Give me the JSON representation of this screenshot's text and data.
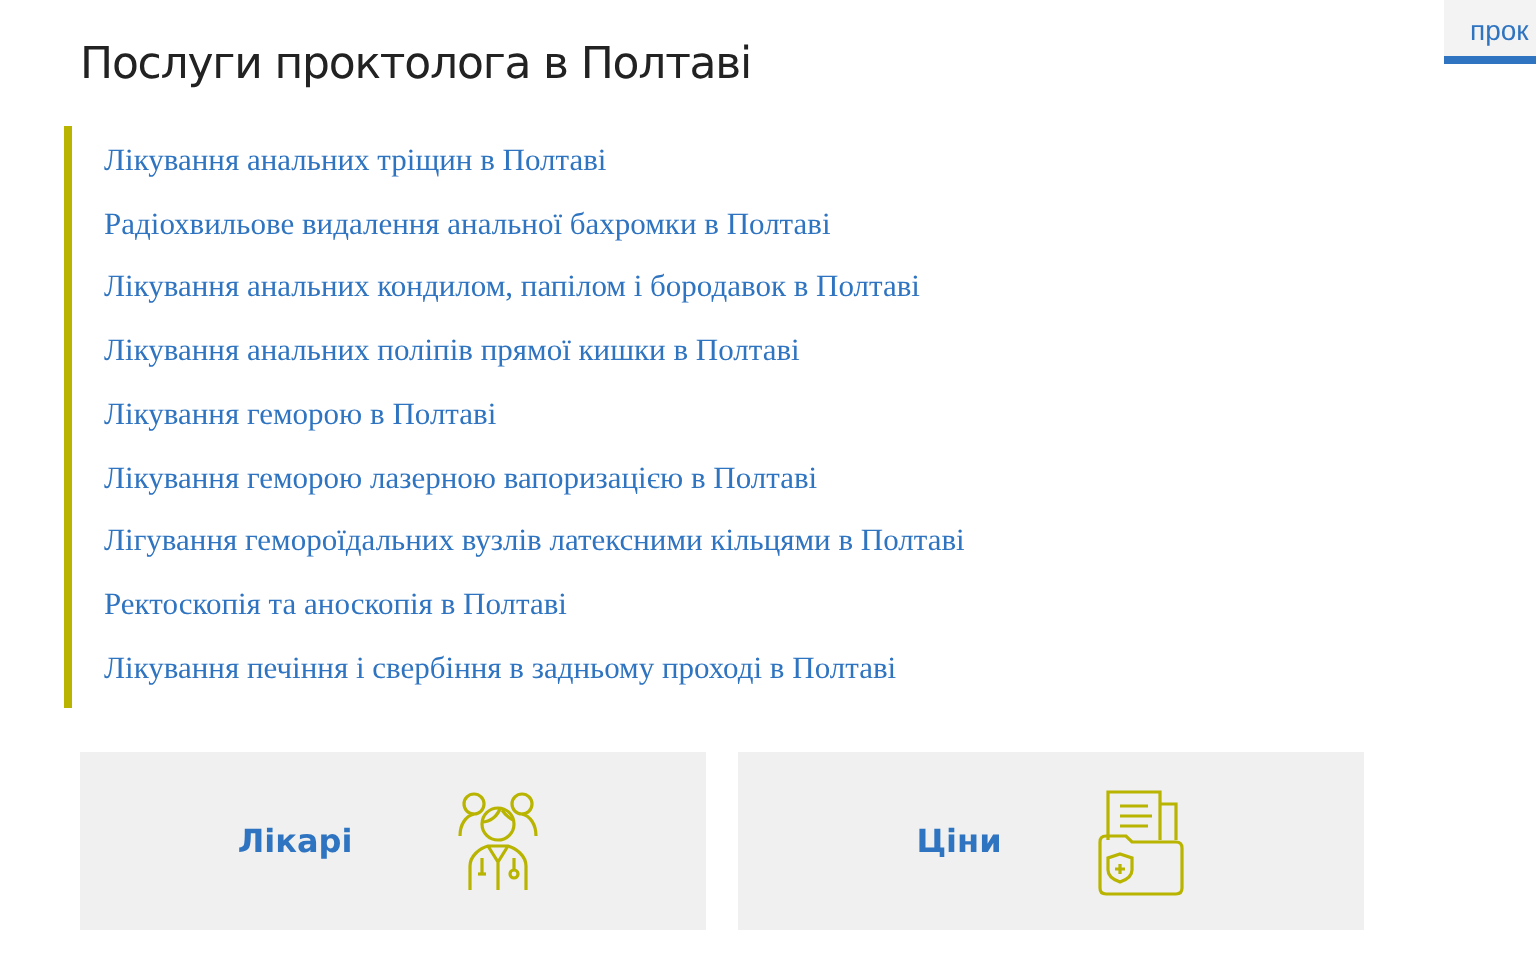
{
  "heading": "Послуги проктолога в Полтаві",
  "side_tab": {
    "label": "прок",
    "selected": true
  },
  "services": [
    "Лікування анальних тріщин в Полтаві",
    "Радіохвильове видалення анальної бахромки в Полтаві",
    "Лікування анальних кондилом, папілом і бородавок в Полтаві",
    "Лікування анальних поліпів прямої кишки в Полтаві",
    "Лікування геморою в Полтаві",
    "Лікування геморою лазерною вапоризацією в Полтаві",
    "Лігування гемороїдальних вузлів латексними кільцями в Полтаві",
    "Ректоскопія та аноскопія в Полтаві",
    "Лікування печіння і свербіння в задньому проході в Полтаві"
  ],
  "cards": [
    {
      "label": "Лікарі",
      "kind": "doctors"
    },
    {
      "label": "Ціни",
      "kind": "documents"
    }
  ]
}
